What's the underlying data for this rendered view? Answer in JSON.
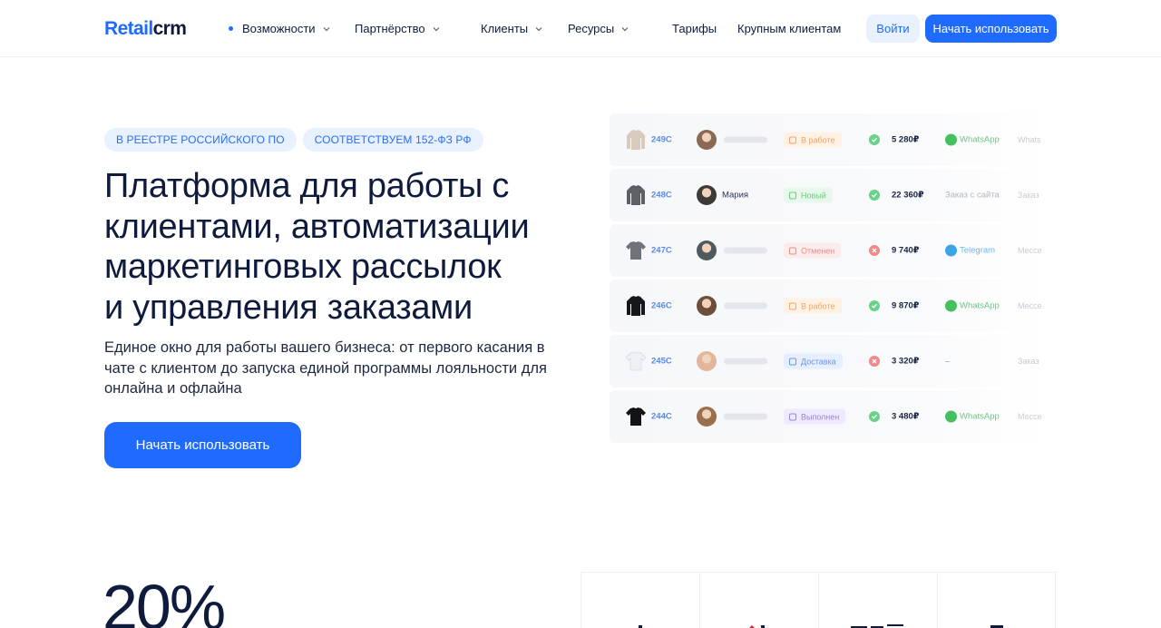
{
  "header": {
    "logo_blue": "Retail",
    "logo_dark": "crm",
    "nav": [
      {
        "label": "Возможности",
        "dropdown": true,
        "active": true
      },
      {
        "label": "Партнёрство",
        "dropdown": true
      },
      {
        "label": "Клиенты",
        "dropdown": true
      },
      {
        "label": "Ресурсы",
        "dropdown": true
      },
      {
        "label": "Тарифы",
        "dropdown": false
      },
      {
        "label": "Крупным клиентам",
        "dropdown": false
      }
    ],
    "login_label": "Войти",
    "start_label": "Начать использовать"
  },
  "hero": {
    "badges": [
      "В РЕЕСТРЕ РОССИЙСКОГО ПО",
      "СООТВЕТСТВУЕМ 152-ФЗ РФ"
    ],
    "title_lines": [
      "Платформа для работы с",
      "клиентами, автоматизации",
      "маркетинговых рассылок",
      "и управления заказами"
    ],
    "subtitle": "Единое окно для работы вашего бизнеса: от первого касания в чате с клиентом до запуска единой программы лояльности для онлайна и офлайна",
    "cta_label": "Начать использовать"
  },
  "orders": [
    {
      "number": "249C",
      "product": "beige-sweater",
      "avatar": "avatar-1",
      "customer": "",
      "status": "В работе",
      "status_kind": "orange",
      "paid": true,
      "sum": "5 280₽",
      "channel": "WhatsApp",
      "channel_kind": "whatsapp",
      "extra": "Whats"
    },
    {
      "number": "248C",
      "product": "grey-jacket",
      "avatar": "avatar-2",
      "customer": "Мария",
      "status": "Новый",
      "status_kind": "green",
      "paid": true,
      "sum": "22 360₽",
      "channel": "Заказ с сайта",
      "channel_kind": "site",
      "extra": "Заказ"
    },
    {
      "number": "247C",
      "product": "grey-sweatshirt",
      "avatar": "avatar-3",
      "customer": "",
      "status": "Отменен",
      "status_kind": "red",
      "paid": false,
      "sum": "9 740₽",
      "channel": "Telegram",
      "channel_kind": "telegram",
      "extra": "Мессе"
    },
    {
      "number": "246C",
      "product": "black-jacket",
      "avatar": "avatar-4",
      "customer": "",
      "status": "В работе",
      "status_kind": "orange",
      "paid": true,
      "sum": "9 870₽",
      "channel": "WhatsApp",
      "channel_kind": "whatsapp",
      "extra": "Мессе"
    },
    {
      "number": "245C",
      "product": "white-tshirt",
      "avatar": "avatar-5",
      "customer": "",
      "status": "Доставка",
      "status_kind": "blue",
      "paid": false,
      "sum": "3 320₽",
      "channel": "–",
      "channel_kind": "none",
      "extra": "Заказ"
    },
    {
      "number": "244C",
      "product": "black-tshirt",
      "avatar": "avatar-6",
      "customer": "",
      "status": "Выполнен",
      "status_kind": "purple",
      "paid": true,
      "sum": "3 480₽",
      "channel": "WhatsApp",
      "channel_kind": "whatsapp",
      "extra": "Мессе"
    }
  ],
  "stats": {
    "big_value": "20%"
  },
  "colors": {
    "accent": "#1f6bff",
    "orange_bg": "#fff1e4",
    "orange_fg": "#f0a46a",
    "green_bg": "#e9f8ec",
    "green_fg": "#6cc77f",
    "red_bg": "#fdecec",
    "red_fg": "#e88b8b",
    "blue_bg": "#e6efff",
    "blue_fg": "#6b94e6",
    "purple_bg": "#efeaff",
    "purple_fg": "#9a86d8",
    "paid": "#6bd08a",
    "unpaid": "#ef8a8a",
    "whatsapp": "#44c05f",
    "telegram": "#3aa4e4"
  }
}
